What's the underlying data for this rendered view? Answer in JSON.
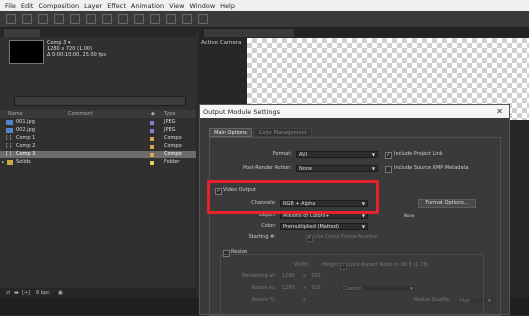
{
  "menu": [
    "File",
    "Edit",
    "Composition",
    "Layer",
    "Effect",
    "Animation",
    "View",
    "Window",
    "Help"
  ],
  "project": {
    "comp_name": "Comp 3 ▾",
    "comp_info": [
      "1280 x 720 (1.00)",
      "Δ 0:00:10:00, 25.00 fps"
    ],
    "columns": {
      "name": "Name",
      "comment": "Comment",
      "type": "Type"
    },
    "items": [
      {
        "name": "001.jpg",
        "type": "JPEG",
        "color": "#8a7fd0",
        "icon": "image-icon"
      },
      {
        "name": "002.jpg",
        "type": "JPEG",
        "color": "#8a7fd0",
        "icon": "image-icon"
      },
      {
        "name": "Comp 1",
        "type": "Compo",
        "color": "#d9a84a",
        "icon": "composition-icon"
      },
      {
        "name": "Comp 2",
        "type": "Compo",
        "color": "#d9a84a",
        "icon": "composition-icon"
      },
      {
        "name": "Comp 3",
        "type": "Compo",
        "color": "#d9a84a",
        "icon": "composition-icon",
        "selected": true
      },
      {
        "name": "Solids",
        "type": "Folder",
        "color": "#e6d35a",
        "icon": "folder-icon"
      }
    ],
    "footer_bpc": "8 bpc"
  },
  "viewer": {
    "label": "Active Camera"
  },
  "dialog": {
    "title": "Output Module Settings",
    "close": "✕",
    "tabs": [
      "Main Options",
      "Color Management"
    ],
    "format_label": "Format:",
    "format_value": "AVI",
    "include_project_link": "Include Project Link",
    "post_render_label": "Post-Render Action:",
    "post_render_value": "None",
    "include_xmp": "Include Source XMP Metadata",
    "video_output": "Video Output",
    "channels_label": "Channels:",
    "channels_value": "RGB + Alpha",
    "format_options": "Format Options...",
    "depth_label": "Depth:",
    "depth_value": "Millions of Colors+",
    "none_text": "None",
    "color_label": "Color:",
    "color_value": "Premultiplied (Matted)",
    "starting_label": "Starting #:",
    "use_comp_frame": "Use Comp Frame Number",
    "resize": "Resize",
    "width": "Width",
    "height": "Height",
    "lock_aspect": "Lock Aspect Ratio to 16:9 (1.78)",
    "rendering_at": "Rendering at:",
    "rendering_w": "1280",
    "rendering_h": "720",
    "resize_to": "Resize to:",
    "resize_w": "1280",
    "resize_h": "720",
    "custom": "Custom",
    "resize_pct": "Resize %:",
    "resize_quality": "Resize Quality:",
    "quality_value": "High"
  }
}
